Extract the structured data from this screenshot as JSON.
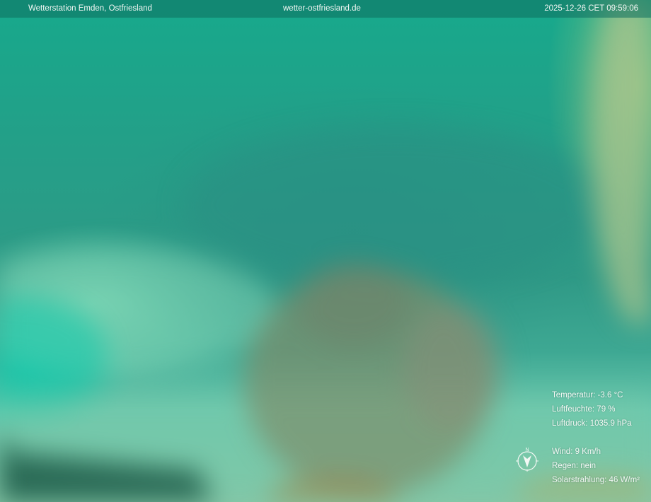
{
  "header": {
    "station": "Wetterstation Emden, Ostfriesland",
    "website": "wetter-ostfriesland.de",
    "timestamp": "2025-12-26 CET 09:59:06"
  },
  "readings": {
    "temperature": "Temperatur: -3.6 °C",
    "humidity": "Luftfeuchte: 79 %",
    "pressure": "Luftdruck: 1035.9 hPa",
    "wind": "Wind: 9 Km/h",
    "rain": "Regen: nein",
    "solar": "Solarstrahlung: 46 W/m²"
  },
  "compass": {
    "north_label": "N",
    "icon": "compass-icon"
  },
  "colors": {
    "sky_teal": "#1aa98f",
    "overlay_text": "#f2f7f4"
  }
}
